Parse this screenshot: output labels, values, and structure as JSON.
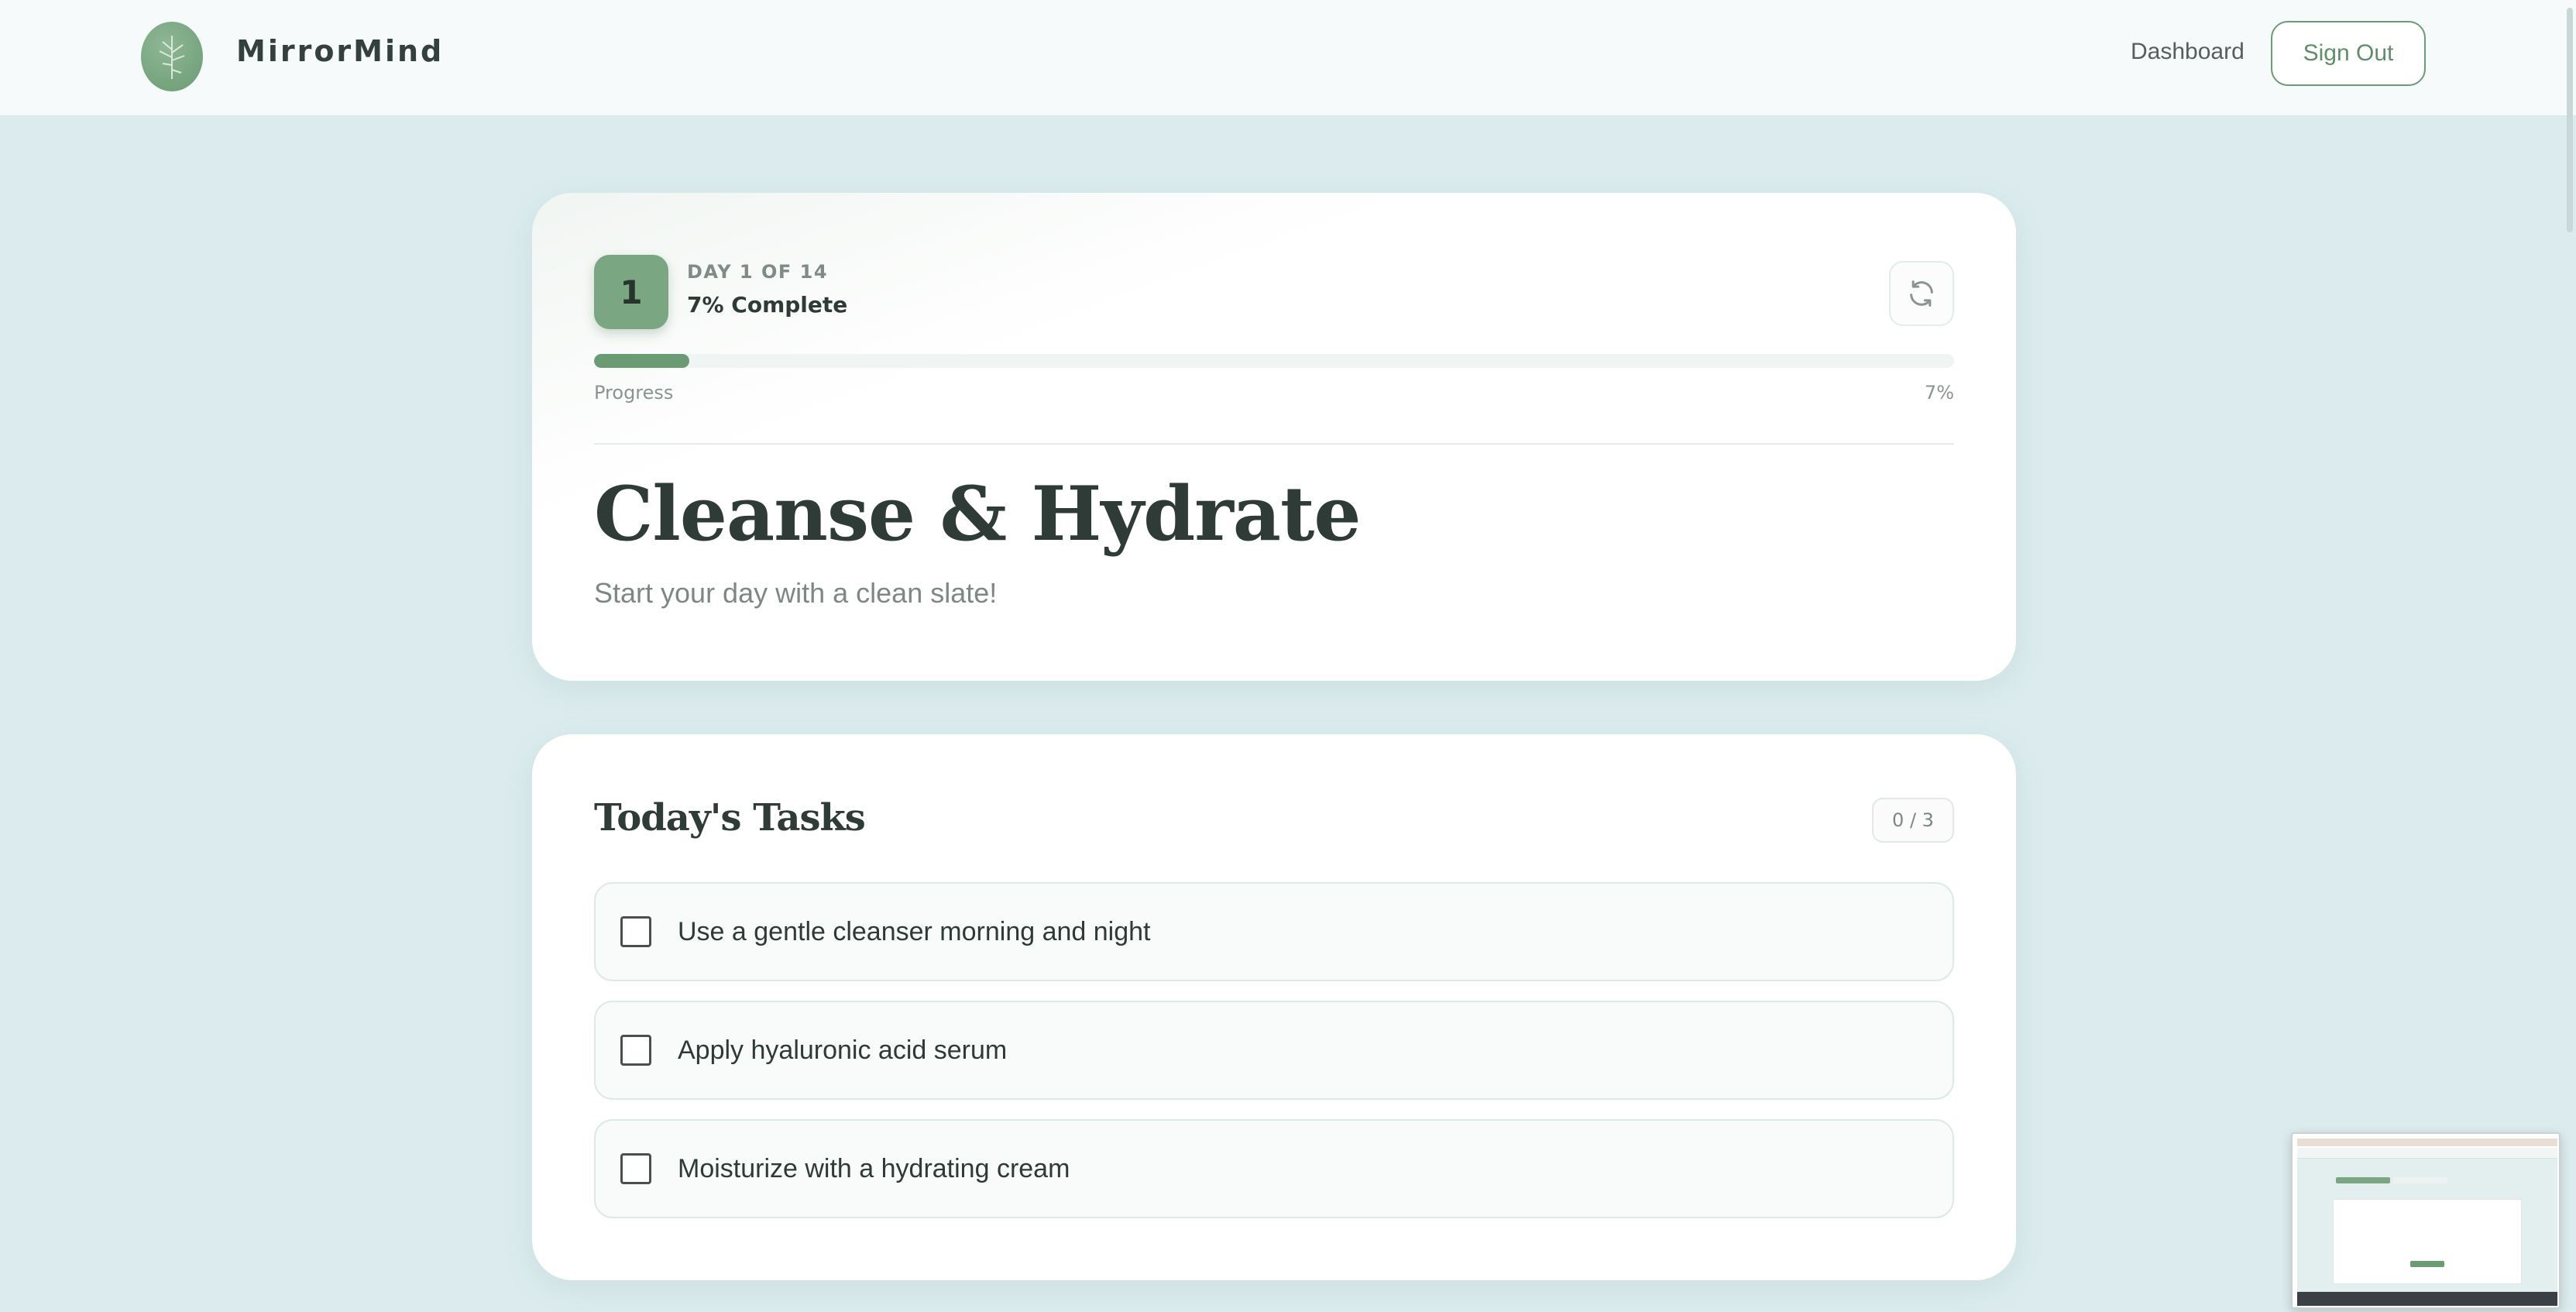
{
  "header": {
    "brand": "MirrorMind",
    "nav_dashboard": "Dashboard",
    "sign_out": "Sign Out"
  },
  "day_card": {
    "badge": "1",
    "kicker": "DAY 1 OF 14",
    "complete_text": "7% Complete",
    "progress_label": "Progress",
    "progress_value_text": "7%",
    "progress_fraction": 0.07,
    "title": "Cleanse & Hydrate",
    "subtitle": "Start your day with a clean slate!"
  },
  "tasks": {
    "title": "Today's Tasks",
    "count": "0 / 3",
    "items": [
      {
        "label": "Use a gentle cleanser morning and night",
        "checked": false
      },
      {
        "label": "Apply hyaluronic acid serum",
        "checked": false
      },
      {
        "label": "Moisturize with a hydrating cream",
        "checked": false
      }
    ]
  },
  "icons": {
    "logo": "plant-leaf-icon",
    "refresh": "refresh-icon"
  },
  "colors": {
    "accent": "#6a9b72",
    "background": "#dcecee",
    "text": "#2e3a36"
  }
}
